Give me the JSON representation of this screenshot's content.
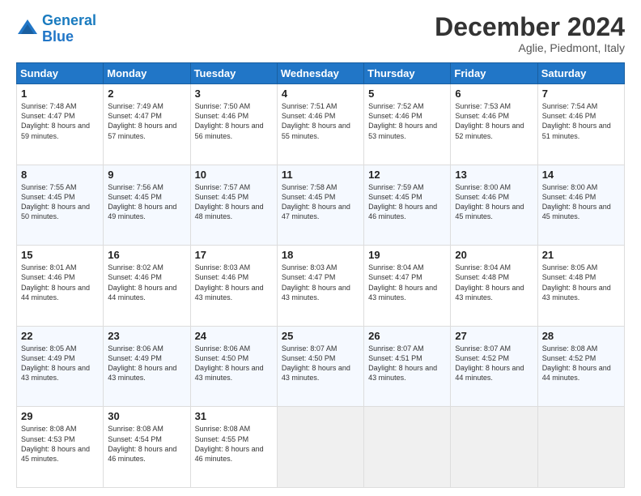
{
  "header": {
    "logo_line1": "General",
    "logo_line2": "Blue",
    "month": "December 2024",
    "location": "Aglie, Piedmont, Italy"
  },
  "days_of_week": [
    "Sunday",
    "Monday",
    "Tuesday",
    "Wednesday",
    "Thursday",
    "Friday",
    "Saturday"
  ],
  "weeks": [
    [
      {
        "day": "1",
        "rise": "7:48 AM",
        "set": "4:47 PM",
        "daylight": "8 hours and 59 minutes."
      },
      {
        "day": "2",
        "rise": "7:49 AM",
        "set": "4:47 PM",
        "daylight": "8 hours and 57 minutes."
      },
      {
        "day": "3",
        "rise": "7:50 AM",
        "set": "4:46 PM",
        "daylight": "8 hours and 56 minutes."
      },
      {
        "day": "4",
        "rise": "7:51 AM",
        "set": "4:46 PM",
        "daylight": "8 hours and 55 minutes."
      },
      {
        "day": "5",
        "rise": "7:52 AM",
        "set": "4:46 PM",
        "daylight": "8 hours and 53 minutes."
      },
      {
        "day": "6",
        "rise": "7:53 AM",
        "set": "4:46 PM",
        "daylight": "8 hours and 52 minutes."
      },
      {
        "day": "7",
        "rise": "7:54 AM",
        "set": "4:46 PM",
        "daylight": "8 hours and 51 minutes."
      }
    ],
    [
      {
        "day": "8",
        "rise": "7:55 AM",
        "set": "4:45 PM",
        "daylight": "8 hours and 50 minutes."
      },
      {
        "day": "9",
        "rise": "7:56 AM",
        "set": "4:45 PM",
        "daylight": "8 hours and 49 minutes."
      },
      {
        "day": "10",
        "rise": "7:57 AM",
        "set": "4:45 PM",
        "daylight": "8 hours and 48 minutes."
      },
      {
        "day": "11",
        "rise": "7:58 AM",
        "set": "4:45 PM",
        "daylight": "8 hours and 47 minutes."
      },
      {
        "day": "12",
        "rise": "7:59 AM",
        "set": "4:45 PM",
        "daylight": "8 hours and 46 minutes."
      },
      {
        "day": "13",
        "rise": "8:00 AM",
        "set": "4:46 PM",
        "daylight": "8 hours and 45 minutes."
      },
      {
        "day": "14",
        "rise": "8:00 AM",
        "set": "4:46 PM",
        "daylight": "8 hours and 45 minutes."
      }
    ],
    [
      {
        "day": "15",
        "rise": "8:01 AM",
        "set": "4:46 PM",
        "daylight": "8 hours and 44 minutes."
      },
      {
        "day": "16",
        "rise": "8:02 AM",
        "set": "4:46 PM",
        "daylight": "8 hours and 44 minutes."
      },
      {
        "day": "17",
        "rise": "8:03 AM",
        "set": "4:46 PM",
        "daylight": "8 hours and 43 minutes."
      },
      {
        "day": "18",
        "rise": "8:03 AM",
        "set": "4:47 PM",
        "daylight": "8 hours and 43 minutes."
      },
      {
        "day": "19",
        "rise": "8:04 AM",
        "set": "4:47 PM",
        "daylight": "8 hours and 43 minutes."
      },
      {
        "day": "20",
        "rise": "8:04 AM",
        "set": "4:48 PM",
        "daylight": "8 hours and 43 minutes."
      },
      {
        "day": "21",
        "rise": "8:05 AM",
        "set": "4:48 PM",
        "daylight": "8 hours and 43 minutes."
      }
    ],
    [
      {
        "day": "22",
        "rise": "8:05 AM",
        "set": "4:49 PM",
        "daylight": "8 hours and 43 minutes."
      },
      {
        "day": "23",
        "rise": "8:06 AM",
        "set": "4:49 PM",
        "daylight": "8 hours and 43 minutes."
      },
      {
        "day": "24",
        "rise": "8:06 AM",
        "set": "4:50 PM",
        "daylight": "8 hours and 43 minutes."
      },
      {
        "day": "25",
        "rise": "8:07 AM",
        "set": "4:50 PM",
        "daylight": "8 hours and 43 minutes."
      },
      {
        "day": "26",
        "rise": "8:07 AM",
        "set": "4:51 PM",
        "daylight": "8 hours and 43 minutes."
      },
      {
        "day": "27",
        "rise": "8:07 AM",
        "set": "4:52 PM",
        "daylight": "8 hours and 44 minutes."
      },
      {
        "day": "28",
        "rise": "8:08 AM",
        "set": "4:52 PM",
        "daylight": "8 hours and 44 minutes."
      }
    ],
    [
      {
        "day": "29",
        "rise": "8:08 AM",
        "set": "4:53 PM",
        "daylight": "8 hours and 45 minutes."
      },
      {
        "day": "30",
        "rise": "8:08 AM",
        "set": "4:54 PM",
        "daylight": "8 hours and 46 minutes."
      },
      {
        "day": "31",
        "rise": "8:08 AM",
        "set": "4:55 PM",
        "daylight": "8 hours and 46 minutes."
      },
      null,
      null,
      null,
      null
    ]
  ]
}
